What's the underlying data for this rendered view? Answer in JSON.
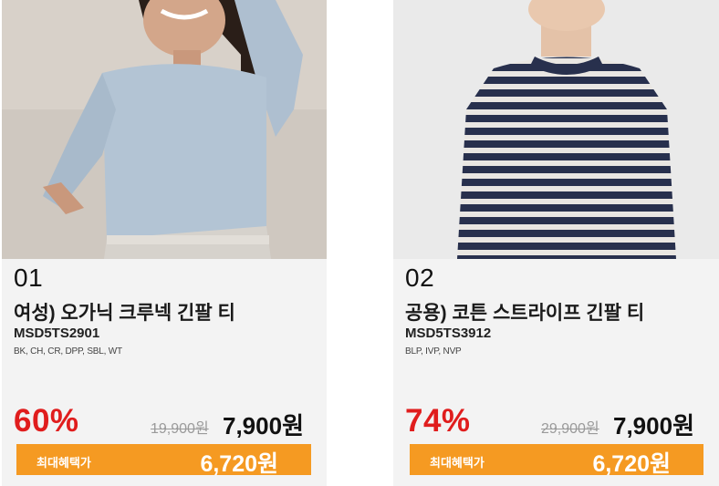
{
  "colors": {
    "discount": "#e01d1d",
    "benefit_bar": "#f59a22",
    "card_bg": "#f3f3f3"
  },
  "products": [
    {
      "rank": "01",
      "name": "여성) 오가닉 크루넥 긴팔 티",
      "code": "MSD5TS2901",
      "colors": "BK, CH, CR, DPP, SBL, WT",
      "discount": "60%",
      "original_price": "19,900원",
      "price": "7,900원",
      "benefit_label": "최대혜택가",
      "benefit_price": "6,720원",
      "image": "woman-light-blue-long-sleeve-tee"
    },
    {
      "rank": "02",
      "name": "공용) 코튼 스트라이프 긴팔 티",
      "code": "MSD5TS3912",
      "colors": "BLP, IVP, NVP",
      "discount": "74%",
      "original_price": "29,900원",
      "price": "7,900원",
      "benefit_label": "최대혜택가",
      "benefit_price": "6,720원",
      "image": "man-navy-white-striped-long-sleeve-tee"
    }
  ]
}
